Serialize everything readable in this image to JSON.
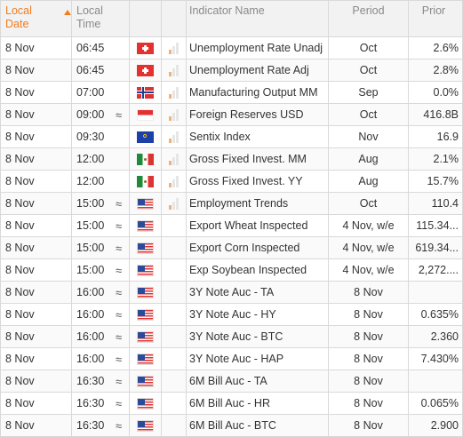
{
  "header": {
    "local_date": "Local Date",
    "local_time": "Local Time",
    "indicator_name": "Indicator Name",
    "period": "Period",
    "prior": "Prior"
  },
  "rows": [
    {
      "date": "8 Nov",
      "time": "06:45",
      "approx": "",
      "flag": "Switzerland",
      "importance": true,
      "name": "Unemployment Rate Unadj",
      "period": "Oct",
      "prior": "2.6%"
    },
    {
      "date": "8 Nov",
      "time": "06:45",
      "approx": "",
      "flag": "Switzerland",
      "importance": true,
      "name": "Unemployment Rate Adj",
      "period": "Oct",
      "prior": "2.8%"
    },
    {
      "date": "8 Nov",
      "time": "07:00",
      "approx": "",
      "flag": "Norway",
      "importance": true,
      "name": "Manufacturing Output MM",
      "period": "Sep",
      "prior": "0.0%"
    },
    {
      "date": "8 Nov",
      "time": "09:00",
      "approx": "≈",
      "flag": "Singapore",
      "importance": true,
      "name": "Foreign Reserves USD",
      "period": "Oct",
      "prior": "416.8B"
    },
    {
      "date": "8 Nov",
      "time": "09:30",
      "approx": "",
      "flag": "Euro Zone",
      "importance": true,
      "name": "Sentix Index",
      "period": "Nov",
      "prior": "16.9"
    },
    {
      "date": "8 Nov",
      "time": "12:00",
      "approx": "",
      "flag": "Mexico",
      "importance": true,
      "name": "Gross Fixed Invest. MM",
      "period": "Aug",
      "prior": "2.1%"
    },
    {
      "date": "8 Nov",
      "time": "12:00",
      "approx": "",
      "flag": "Mexico",
      "importance": true,
      "name": "Gross Fixed Invest. YY",
      "period": "Aug",
      "prior": "15.7%"
    },
    {
      "date": "8 Nov",
      "time": "15:00",
      "approx": "≈",
      "flag": "United States",
      "importance": true,
      "name": "Employment Trends",
      "period": "Oct",
      "prior": "110.4"
    },
    {
      "date": "8 Nov",
      "time": "15:00",
      "approx": "≈",
      "flag": "United States",
      "importance": false,
      "name": "Export Wheat Inspected",
      "period": "4 Nov, w/e",
      "prior": "115.34..."
    },
    {
      "date": "8 Nov",
      "time": "15:00",
      "approx": "≈",
      "flag": "United States",
      "importance": false,
      "name": "Export Corn Inspected",
      "period": "4 Nov, w/e",
      "prior": "619.34..."
    },
    {
      "date": "8 Nov",
      "time": "15:00",
      "approx": "≈",
      "flag": "United States",
      "importance": false,
      "name": "Exp Soybean Inspected",
      "period": "4 Nov, w/e",
      "prior": "2,272...."
    },
    {
      "date": "8 Nov",
      "time": "16:00",
      "approx": "≈",
      "flag": "United States",
      "importance": false,
      "name": "3Y Note Auc - TA",
      "period": "8 Nov",
      "prior": ""
    },
    {
      "date": "8 Nov",
      "time": "16:00",
      "approx": "≈",
      "flag": "United States",
      "importance": false,
      "name": "3Y Note Auc - HY",
      "period": "8 Nov",
      "prior": "0.635%"
    },
    {
      "date": "8 Nov",
      "time": "16:00",
      "approx": "≈",
      "flag": "United States",
      "importance": false,
      "name": "3Y Note Auc - BTC",
      "period": "8 Nov",
      "prior": "2.360"
    },
    {
      "date": "8 Nov",
      "time": "16:00",
      "approx": "≈",
      "flag": "United States",
      "importance": false,
      "name": "3Y Note Auc - HAP",
      "period": "8 Nov",
      "prior": "7.430%"
    },
    {
      "date": "8 Nov",
      "time": "16:30",
      "approx": "≈",
      "flag": "United States",
      "importance": false,
      "name": "6M Bill Auc - TA",
      "period": "8 Nov",
      "prior": ""
    },
    {
      "date": "8 Nov",
      "time": "16:30",
      "approx": "≈",
      "flag": "United States",
      "importance": false,
      "name": "6M Bill Auc - HR",
      "period": "8 Nov",
      "prior": "0.065%"
    },
    {
      "date": "8 Nov",
      "time": "16:30",
      "approx": "≈",
      "flag": "United States",
      "importance": false,
      "name": "6M Bill Auc - BTC",
      "period": "8 Nov",
      "prior": "2.900"
    }
  ],
  "flag_classes": {
    "Switzerland": "flag-ch",
    "Norway": "flag-no",
    "Singapore": "flag-sg",
    "Euro Zone": "flag-eu",
    "Mexico": "flag-mx",
    "United States": "flag-us"
  },
  "colors": {
    "accent": "#ef7d22",
    "header_text": "#8a8a8a",
    "border": "#d9d9d9"
  },
  "icons": {
    "sort": "sort-ascending-icon",
    "approx": "approximately-equal-icon",
    "importance": "importance-bars-icon"
  }
}
